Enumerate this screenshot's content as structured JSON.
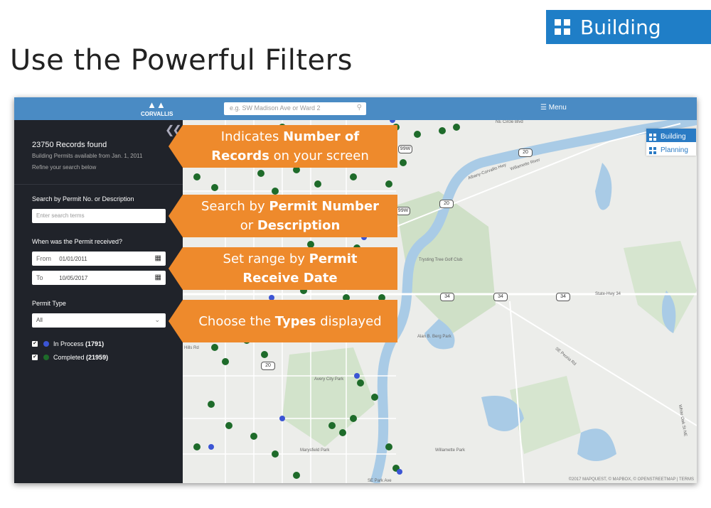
{
  "slide": {
    "badge_label": "Building",
    "title": "Use the Powerful Filters"
  },
  "app": {
    "logo_text": "CORVALLIS",
    "search_placeholder": "e.g. SW Madison Ave or Ward 2",
    "menu_label": "Menu"
  },
  "sidebar": {
    "records_found": "23750 Records found",
    "available_from": "Building Permits available from Jan. 1, 2011",
    "refine_hint": "Refine your search below",
    "search_label": "Search by Permit No. or Description",
    "search_placeholder": "Enter search terms",
    "date_label": "When was the Permit received?",
    "from_prefix": "From",
    "from_value": "01/01/2011",
    "to_prefix": "To",
    "to_value": "10/05/2017",
    "type_label": "Permit Type",
    "type_value": "All",
    "legend": [
      {
        "label": "In Process",
        "count": "(1791)",
        "color": "#3b55d4",
        "checked": true
      },
      {
        "label": "Completed",
        "count": "(21959)",
        "color": "#1e6b2a",
        "checked": true
      }
    ]
  },
  "map": {
    "layers": [
      {
        "label": "Building",
        "active": true
      },
      {
        "label": "Planning",
        "active": false
      }
    ],
    "attribution": "©2017 MAPQUEST, © MAPBOX, © OPENSTREETMAP | TERMS",
    "labels": [
      "NE Circle Blvd",
      "Albany-Corvallis Hwy",
      "Willamette River",
      "Trysting Tree Golf Club",
      "State-Hwy 34",
      "SE Peoria Rd",
      "Alan B. Berg Park",
      "Avery City Park",
      "Marysfield Park",
      "Willamette Park",
      "SE Park Ave",
      "White Oak St NE",
      "Hills Rd"
    ],
    "routes": [
      "99W",
      "20",
      "34",
      "34",
      "34",
      "20",
      "99W",
      "20"
    ]
  },
  "callouts": [
    {
      "pre": "Indicates ",
      "bold": "Number of",
      "line2_bold": "Records",
      "line2_post": " on your screen"
    },
    {
      "pre": "Search by ",
      "bold": "Permit Number",
      "line2_pre": "or ",
      "line2_bold": "Description"
    },
    {
      "pre": "Set range by ",
      "bold": "Permit",
      "line2_bold": "Receive Date"
    },
    {
      "pre": "Choose the ",
      "bold": "Types",
      "post": " displayed"
    }
  ]
}
